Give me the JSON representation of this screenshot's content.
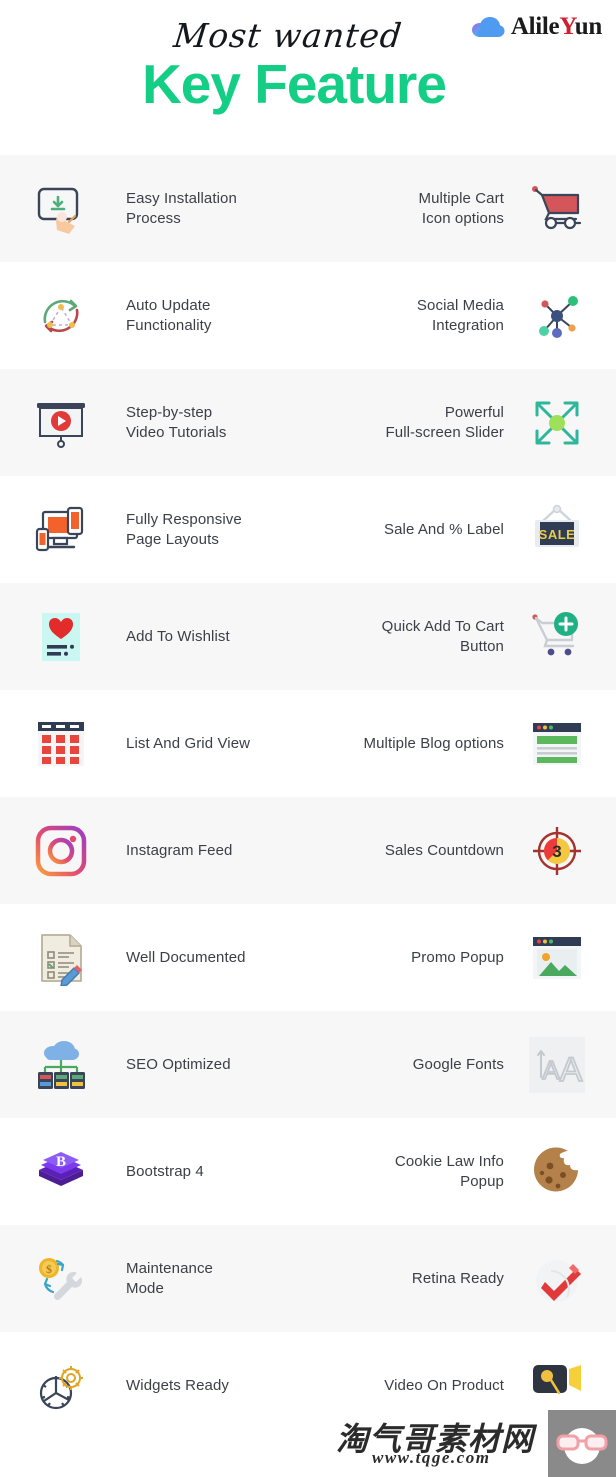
{
  "header": {
    "script_text": "Most wanted",
    "title_text": "Key Feature",
    "brand": {
      "name_part1": "Alile",
      "name_highlight": "Y",
      "name_part2": "un",
      "icon": "cloud-icon"
    },
    "colors": {
      "title_green": "#15ce86",
      "brand_red": "#cf2030",
      "text_dark": "#3c4046",
      "row_shade": "#f7f7f7"
    }
  },
  "features": [
    {
      "left_label": "Easy Installation\nProcess",
      "left_icon": "install-tap-icon",
      "right_label": "Multiple Cart\nIcon options",
      "right_icon": "shopping-cart-icon",
      "shaded": true
    },
    {
      "left_label": "Auto Update\nFunctionality",
      "left_icon": "auto-update-icon",
      "right_label": "Social Media\nIntegration",
      "right_icon": "social-network-icon",
      "shaded": false
    },
    {
      "left_label": "Step-by-step\nVideo Tutorials",
      "left_icon": "video-tutorial-icon",
      "right_label": "Powerful\nFull-screen Slider",
      "right_icon": "fullscreen-expand-icon",
      "shaded": true
    },
    {
      "left_label": "Fully Responsive\nPage Layouts",
      "left_icon": "responsive-devices-icon",
      "right_label": "Sale And % Label",
      "right_icon": "sale-sign-icon",
      "shaded": false
    },
    {
      "left_label": "Add To Wishlist",
      "left_icon": "wishlist-heart-icon",
      "right_label": "Quick Add To Cart\nButton",
      "right_icon": "add-to-cart-icon",
      "shaded": true
    },
    {
      "left_label": "List And Grid View",
      "left_icon": "grid-view-icon",
      "right_label": "Multiple Blog options",
      "right_icon": "blog-layout-icon",
      "shaded": false
    },
    {
      "left_label": "Instagram Feed",
      "left_icon": "instagram-icon",
      "right_label": "Sales Countdown",
      "right_icon": "countdown-target-icon",
      "shaded": true
    },
    {
      "left_label": "Well Documented",
      "left_icon": "document-pencil-icon",
      "right_label": "Promo Popup",
      "right_icon": "popup-image-icon",
      "shaded": false
    },
    {
      "left_label": "SEO Optimized",
      "left_icon": "cloud-servers-icon",
      "right_label": "Google Fonts",
      "right_icon": "font-size-icon",
      "shaded": true
    },
    {
      "left_label": "Bootstrap 4",
      "left_icon": "bootstrap-icon",
      "right_label": "Cookie Law Info\nPopup",
      "right_icon": "cookie-icon",
      "shaded": false
    },
    {
      "left_label": "Maintenance\nMode",
      "left_icon": "coin-wrench-icon",
      "right_label": "Retina Ready",
      "right_icon": "red-check-icon",
      "shaded": true
    },
    {
      "left_label": "Widgets Ready",
      "left_icon": "gear-widget-icon",
      "right_label": "Video On Product",
      "right_icon": "video-product-icon",
      "shaded": false
    }
  ],
  "watermark": {
    "chinese": "淘气哥素材网",
    "url": "www.tqge.com",
    "badge_icon": "glasses-icon"
  }
}
